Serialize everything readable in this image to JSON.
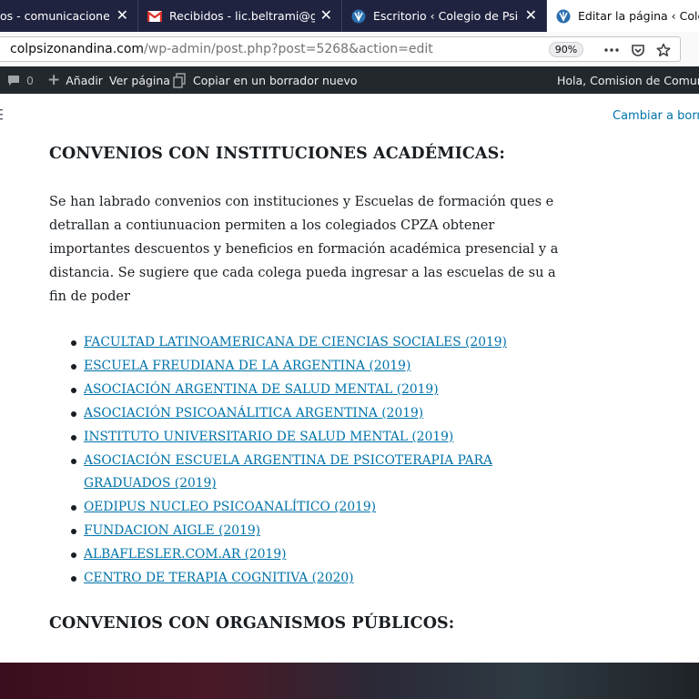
{
  "browser": {
    "tabs": [
      {
        "title": "os - comunicacioneswe",
        "icon": "page-icon"
      },
      {
        "title": "Recibidos - lic.beltrami@gmail",
        "icon": "gmail-icon"
      },
      {
        "title": "Escritorio ‹ Colegio de Psicólog",
        "icon": "site-icon"
      },
      {
        "title": "Editar la página ‹ Colegio",
        "icon": "site-icon"
      }
    ],
    "url": {
      "host": "colpsizonandina.com",
      "path": "/wp-admin/post.php?post=5268&action=edit"
    },
    "zoom": "90%"
  },
  "adminbar": {
    "comments_count": "0",
    "add_label": "Añadir",
    "view_page": "Ver página",
    "copy_draft": "Copiar en un borrador nuevo",
    "greeting": "Hola, Comision de Comunica"
  },
  "editor": {
    "switch_to_draft": "Cambiar a borrad"
  },
  "content": {
    "heading1": "CONVENIOS CON INSTITUCIONES ACADÉMICAS:",
    "paragraph_lines": [
      "Se han labrado convenios con instituciones y Escuelas de formación  ques e",
      "detrallan a contiunuacion permiten a los colegiados CPZA obtener",
      "importantes descuentos y beneficios en formación académica presencial y a",
      "distancia. Se sugiere que cada colega pueda ingresar a las escuelas de su a",
      "fin de poder"
    ],
    "links": [
      "FACULTAD LATINOAMERICANA DE CIENCIAS SOCIALES (2019)",
      "ESCUELA FREUDIANA DE LA ARGENTINA (2019)",
      "ASOCIACIÓN ARGENTINA DE SALUD MENTAL (2019)",
      "ASOCIACIÓN PSICOANÁLITICA ARGENTINA (2019)",
      "INSTITUTO UNIVERSITARIO DE SALUD MENTAL (2019)",
      "ASOCIACIÓN ESCUELA ARGENTINA DE PSICOTERAPIA PARA",
      "GRADUADOS (2019)",
      "OEDIPUS NUCLEO PSICOANALÍTICO (2019)",
      "FUNDACION AIGLE (2019)",
      "ALBAFLESLER.COM.AR (2019)",
      "CENTRO DE TERAPIA COGNITIVA (2020)"
    ],
    "heading2": "CONVENIOS CON ORGANISMOS PÚBLICOS:"
  },
  "colors": {
    "tab_bar": "#202340",
    "admin_bar": "#23282d",
    "link": "#0073aa",
    "text": "#191e23"
  }
}
